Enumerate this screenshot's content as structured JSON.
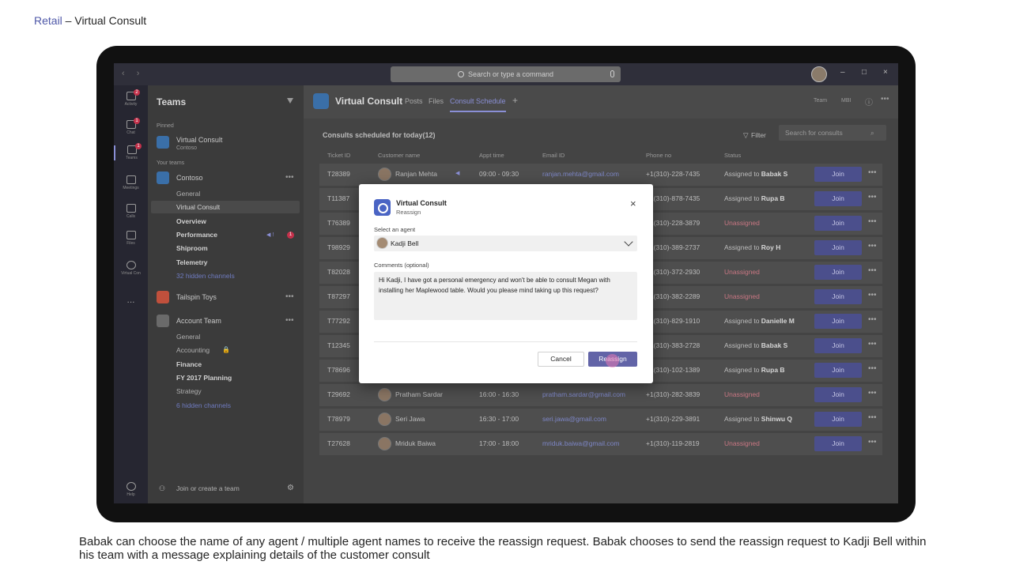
{
  "slide": {
    "title_link": "Retail",
    "title_rest": " – Virtual Consult",
    "caption": "Babak can choose the name of any agent / multiple agent names to receive the reassign request. Babak chooses to send the reassign request to Kadji Bell within his team with a message explaining details of the customer consult"
  },
  "titlebar": {
    "search_placeholder": "Search or type a command",
    "nav_arrows": "‹ ›",
    "minimize": "–",
    "maximize": "□",
    "close": "×"
  },
  "rail": {
    "items": [
      {
        "label": "Activity",
        "icon": "bell-icon",
        "badge": "2"
      },
      {
        "label": "Chat",
        "icon": "chat-icon",
        "badge": "1"
      },
      {
        "label": "Teams",
        "icon": "teams-icon",
        "badge": "1"
      },
      {
        "label": "Meetings",
        "icon": "calendar-icon",
        "badge": ""
      },
      {
        "label": "Calls",
        "icon": "phone-icon",
        "badge": ""
      },
      {
        "label": "Files",
        "icon": "files-icon",
        "badge": ""
      },
      {
        "label": "Virtual Con",
        "icon": "virtual-consult-icon",
        "badge": ""
      }
    ],
    "more": "...",
    "help": "Help"
  },
  "teams_panel": {
    "heading": "Teams",
    "pinned_label": "Pinned",
    "pinned_team": "Virtual Consult",
    "pinned_team_sub": "Contoso",
    "your_teams_label": "Your teams",
    "team1": "Contoso",
    "team1_channels": {
      "general": "General",
      "virtual_consult": "Virtual Consult",
      "overview": "Overview",
      "performance": "Performance",
      "performance_badge": "1",
      "shiproom": "Shiproom",
      "telemetry": "Telemetry",
      "hidden": "32 hidden channels"
    },
    "team2": "Tailspin Toys",
    "team3": "Account Team",
    "team3_channels": {
      "general": "General",
      "accounting": "Accounting",
      "finance": "Finance",
      "fy2017": "FY 2017 Planning",
      "strategy": "Strategy",
      "hidden": "6 hidden channels"
    },
    "join_create": "Join or create a team"
  },
  "main": {
    "app_title": "Virtual Consult",
    "tabs": [
      "Posts",
      "Files",
      "Consult Schedule"
    ],
    "add_tab": "+",
    "team_badge": "Team",
    "mbi_badge": "MBI",
    "content_title": "Consults scheduled for today(12)",
    "filter_label": "Filter",
    "search_placeholder": "Search for consults",
    "columns": {
      "ticket": "Ticket ID",
      "customer": "Customer name",
      "appt": "Appt time",
      "email": "Email ID",
      "phone": "Phone no",
      "status": "Status"
    },
    "join_label": "Join",
    "rows": [
      {
        "ticket": "T28389",
        "name": "Ranjan Mehta",
        "time": "09:00 - 09:30",
        "email": "ranjan.mehta@gmail.com",
        "phone": "+1(310)-228-7435",
        "status": "Assigned to",
        "agent": "Babak S"
      },
      {
        "ticket": "T11387",
        "name": "",
        "time": "",
        "email": "",
        "phone": "+1(310)-878-7435",
        "status": "Assigned to",
        "agent": "Rupa B"
      },
      {
        "ticket": "T76389",
        "name": "",
        "time": "",
        "email": "",
        "phone": "+1(310)-228-3879",
        "status": "Unassigned",
        "agent": ""
      },
      {
        "ticket": "T98929",
        "name": "",
        "time": "",
        "email": "",
        "phone": "+1(310)-389-2737",
        "status": "Assigned to",
        "agent": "Roy H"
      },
      {
        "ticket": "T82028",
        "name": "",
        "time": "",
        "email": "",
        "phone": "+1(310)-372-2930",
        "status": "Unassigned",
        "agent": ""
      },
      {
        "ticket": "T87297",
        "name": "",
        "time": "",
        "email": "",
        "phone": "+1(310)-382-2289",
        "status": "Unassigned",
        "agent": ""
      },
      {
        "ticket": "T77292",
        "name": "",
        "time": "",
        "email": "",
        "phone": "+1(310)-829-1910",
        "status": "Assigned to",
        "agent": "Danielle M"
      },
      {
        "ticket": "T12345",
        "name": "",
        "time": "",
        "email": "",
        "phone": "+1(310)-383-2728",
        "status": "Assigned to",
        "agent": "Babak S"
      },
      {
        "ticket": "T78696",
        "name": "",
        "time": "",
        "email": "",
        "phone": "+1(310)-102-1389",
        "status": "Assigned to",
        "agent": "Rupa B"
      },
      {
        "ticket": "T29692",
        "name": "Pratham Sardar",
        "time": "16:00 - 16:30",
        "email": "pratham.sardar@gmail.com",
        "phone": "+1(310)-282-3839",
        "status": "Unassigned",
        "agent": ""
      },
      {
        "ticket": "T78979",
        "name": "Seri Jawa",
        "time": "16:30 - 17:00",
        "email": "seri.jawa@gmail.com",
        "phone": "+1(310)-229-3891",
        "status": "Assigned to",
        "agent": "Shinwu Q"
      },
      {
        "ticket": "T27628",
        "name": "Mriduk Baiwa",
        "time": "17:00 - 18:00",
        "email": "mriduk.baiwa@gmail.com",
        "phone": "+1(310)-119-2819",
        "status": "Unassigned",
        "agent": ""
      }
    ]
  },
  "dialog": {
    "title": "Virtual Consult",
    "subtitle": "Reassign",
    "close": "×",
    "agent_label": "Select an agent",
    "agent_value": "Kadji Bell",
    "comments_label": "Comments (optional)",
    "comments_value": "Hi Kadji, I have got a personal emergency and won't be able to consult Megan with installing her Maplewood table. Would you please mind taking up this request?",
    "cancel": "Cancel",
    "reassign": "Reassign"
  },
  "colors": {
    "accent": "#6264a7",
    "unassigned": "#c97783",
    "email": "#7d86c6"
  }
}
